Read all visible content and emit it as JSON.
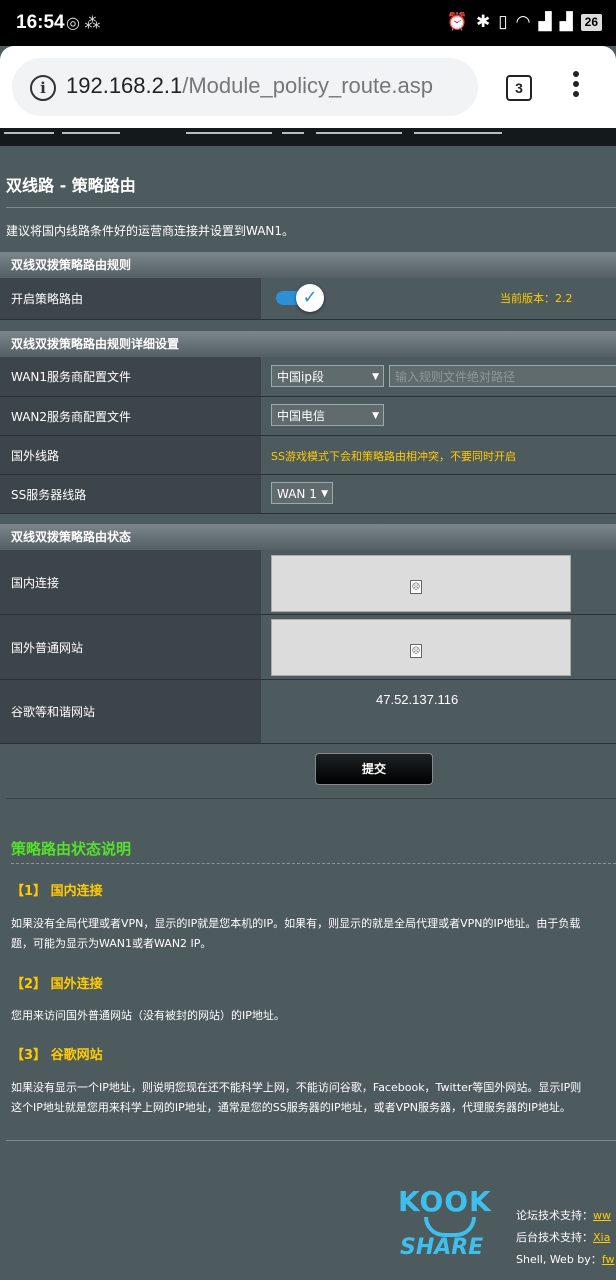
{
  "status_bar": {
    "time": "16:54",
    "left_icons": "◎ ⁂",
    "battery": "26"
  },
  "browser": {
    "host": "192.168.2.1",
    "path": "/Module_policy_route.asp",
    "tab_count": "3"
  },
  "page": {
    "title": "双线路 - 策略路由",
    "advice": "建议将国内线路条件好的运营商连接并设置到WAN1。"
  },
  "section_rules": {
    "header": "双线双拨策略路由规则",
    "enable_label": "开启策略路由",
    "enabled": true,
    "version": "当前版本：2.2"
  },
  "section_detail": {
    "header": "双线双拨策略路由规则详细设置",
    "wan1_label": "WAN1服务商配置文件",
    "wan1_value": "中国ip段",
    "wan1_path_placeholder": "输入规则文件绝对路径",
    "wan2_label": "WAN2服务商配置文件",
    "wan2_value": "中国电信",
    "foreign_label": "国外线路",
    "foreign_warning": "SS游戏模式下会和策略路由相冲突，不要同时开启",
    "ss_label": "SS服务器线路",
    "ss_value": "WAN 1"
  },
  "section_status": {
    "header": "双线双拨策略路由状态",
    "domestic_label": "国内连接",
    "foreign_label": "国外普通网站",
    "google_label": "谷歌等和谐网站",
    "google_ip": "47.52.137.116"
  },
  "submit_label": "提交",
  "explain": {
    "title": "策略路由状态说明",
    "items": [
      {
        "title": "【1】 国内连接",
        "lines": [
          "如果没有全局代理或者VPN，显示的IP就是您本机的IP。如果有，则显示的就是全局代理或者VPN的IP地址。由于负载",
          "题，可能为显示为WAN1或者WAN2 IP。"
        ]
      },
      {
        "title": "【2】 国外连接",
        "lines": [
          "您用来访问国外普通网站（没有被封的网站）的IP地址。"
        ]
      },
      {
        "title": "【3】 谷歌网站",
        "lines": [
          "如果没有显示一个IP地址，则说明您现在还不能科学上网，不能访问谷歌，Facebook，Twitter等国外网站。显示IP则",
          "这个IP地址就是您用来科学上网的IP地址，通常是您的SS服务器的IP地址，或者VPN服务器，代理服务器的IP地址。"
        ]
      }
    ]
  },
  "footer": {
    "logo_top": "KOOK",
    "logo_bottom": "SHARE",
    "forum_label": "论坛技术支持：",
    "forum_link": "ww",
    "backend_label": "后台技术支持：",
    "backend_link": "Xia",
    "shell_label": "Shell, Web by：",
    "shell_link": "fw"
  },
  "colors": {
    "accent_blue": "#2d8fd6",
    "warning_yellow": "#ffcc00",
    "title_green": "#55e02a"
  }
}
